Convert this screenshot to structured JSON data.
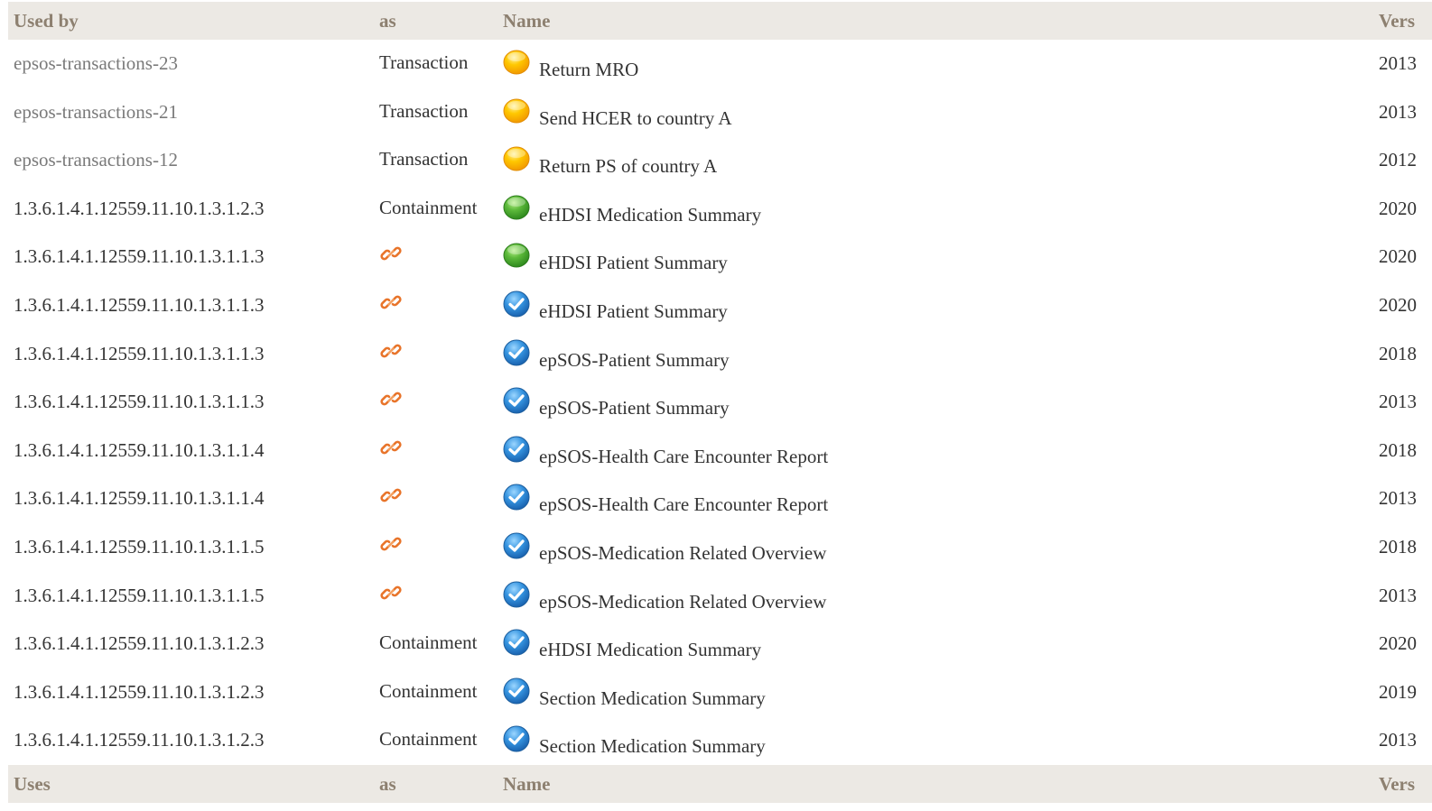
{
  "header_top": {
    "col_used_by": "Used by",
    "col_as": "as",
    "col_name": "Name",
    "col_version": "Vers"
  },
  "rows": [
    {
      "used_by_prefix": "epsos-transactions-",
      "used_by_suffix": "23",
      "as": "Transaction",
      "status_icon": "yellow-dot-icon",
      "name": "Return MRO",
      "version": "2013"
    },
    {
      "used_by_prefix": "epsos-transactions-",
      "used_by_suffix": "21",
      "as": "Transaction",
      "status_icon": "yellow-dot-icon",
      "name": "Send HCER to country A",
      "version": "2013"
    },
    {
      "used_by_prefix": "epsos-transactions-",
      "used_by_suffix": "12",
      "as": "Transaction",
      "status_icon": "yellow-dot-icon",
      "name": "Return PS of country A",
      "version": "2012"
    },
    {
      "used_by": "1.3.6.1.4.1.12559.11.10.1.3.1.2.3",
      "as": "Containment",
      "status_icon": "green-dot-icon",
      "name": "eHDSI Medication Summary",
      "version": "2020"
    },
    {
      "used_by": "1.3.6.1.4.1.12559.11.10.1.3.1.1.3",
      "as_icon": "chain-link-icon",
      "status_icon": "green-dot-icon",
      "name": "eHDSI Patient Summary",
      "version": "2020"
    },
    {
      "used_by": "1.3.6.1.4.1.12559.11.10.1.3.1.1.3",
      "as_icon": "chain-link-icon",
      "status_icon": "blue-check-icon",
      "name": "eHDSI Patient Summary",
      "version": "2020"
    },
    {
      "used_by": "1.3.6.1.4.1.12559.11.10.1.3.1.1.3",
      "as_icon": "chain-link-icon",
      "status_icon": "blue-check-icon",
      "name": "epSOS-Patient Summary",
      "version": "2018"
    },
    {
      "used_by": "1.3.6.1.4.1.12559.11.10.1.3.1.1.3",
      "as_icon": "chain-link-icon",
      "status_icon": "blue-check-icon",
      "name": "epSOS-Patient Summary",
      "version": "2013"
    },
    {
      "used_by": "1.3.6.1.4.1.12559.11.10.1.3.1.1.4",
      "as_icon": "chain-link-icon",
      "status_icon": "blue-check-icon",
      "name": "epSOS-Health Care Encounter Report",
      "version": "2018"
    },
    {
      "used_by": "1.3.6.1.4.1.12559.11.10.1.3.1.1.4",
      "as_icon": "chain-link-icon",
      "status_icon": "blue-check-icon",
      "name": "epSOS-Health Care Encounter Report",
      "version": "2013"
    },
    {
      "used_by": "1.3.6.1.4.1.12559.11.10.1.3.1.1.5",
      "as_icon": "chain-link-icon",
      "status_icon": "blue-check-icon",
      "name": "epSOS-Medication Related Overview",
      "version": "2018"
    },
    {
      "used_by": "1.3.6.1.4.1.12559.11.10.1.3.1.1.5",
      "as_icon": "chain-link-icon",
      "status_icon": "blue-check-icon",
      "name": "epSOS-Medication Related Overview",
      "version": "2013"
    },
    {
      "used_by": "1.3.6.1.4.1.12559.11.10.1.3.1.2.3",
      "as": "Containment",
      "status_icon": "blue-check-icon",
      "name": "eHDSI Medication Summary",
      "version": "2020"
    },
    {
      "used_by": "1.3.6.1.4.1.12559.11.10.1.3.1.2.3",
      "as": "Containment",
      "status_icon": "blue-check-icon",
      "name": "Section Medication Summary",
      "version": "2019"
    },
    {
      "used_by": "1.3.6.1.4.1.12559.11.10.1.3.1.2.3",
      "as": "Containment",
      "status_icon": "blue-check-icon",
      "name": "Section Medication Summary",
      "version": "2013"
    }
  ],
  "header_bottom": {
    "col_uses": "Uses",
    "col_as": "as",
    "col_name": "Name",
    "col_version": "Vers"
  },
  "colors": {
    "header_bg": "#ECE9E4",
    "header_text": "#8D8070",
    "link_gray": "#7a7a7a",
    "chain_orange": "#E8742A",
    "yellow": "#FFC300",
    "green": "#4CAF3A",
    "blue": "#2F8FD8"
  }
}
